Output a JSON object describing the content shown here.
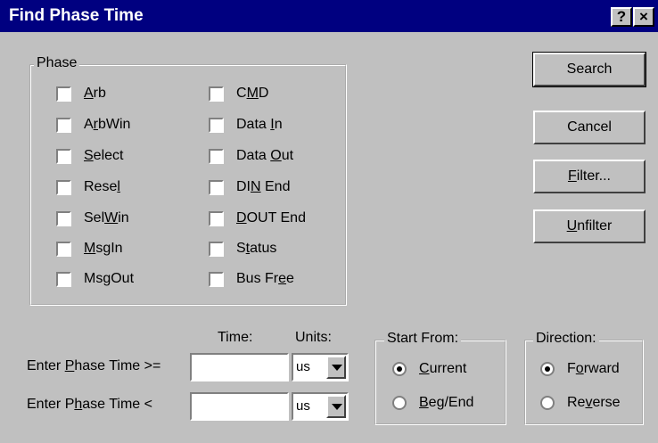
{
  "window": {
    "title": "Find Phase Time",
    "help_label": "?",
    "close_label": "×"
  },
  "phase": {
    "group_label": "Phase",
    "left": [
      {
        "pre": "",
        "u": "A",
        "post": "rb",
        "checked": false
      },
      {
        "pre": "A",
        "u": "r",
        "post": "bWin",
        "checked": false
      },
      {
        "pre": "",
        "u": "S",
        "post": "elect",
        "checked": false
      },
      {
        "pre": "Rese",
        "u": "l",
        "post": "",
        "checked": false
      },
      {
        "pre": "Sel",
        "u": "W",
        "post": "in",
        "checked": false
      },
      {
        "pre": "",
        "u": "M",
        "post": "sgIn",
        "checked": false
      },
      {
        "pre": "Ms",
        "u": "g",
        "post": "Out",
        "checked": false
      }
    ],
    "right": [
      {
        "pre": "C",
        "u": "M",
        "post": "D",
        "checked": false
      },
      {
        "pre": "Data ",
        "u": "I",
        "post": "n",
        "checked": false
      },
      {
        "pre": "Data ",
        "u": "O",
        "post": "ut",
        "checked": false
      },
      {
        "pre": "DI",
        "u": "N",
        "post": " End",
        "checked": false
      },
      {
        "pre": "",
        "u": "D",
        "post": "OUT End",
        "checked": false
      },
      {
        "pre": "S",
        "u": "t",
        "post": "atus",
        "checked": false
      },
      {
        "pre": "Bus Fr",
        "u": "e",
        "post": "e",
        "checked": false
      }
    ]
  },
  "buttons": {
    "search": "Search",
    "cancel": "Cancel",
    "filter": {
      "pre": "",
      "u": "F",
      "post": "ilter..."
    },
    "unfilter": {
      "pre": "",
      "u": "U",
      "post": "nfilter"
    }
  },
  "time": {
    "time_header": "Time:",
    "units_header": "Units:",
    "row1_label": {
      "pre": "Enter ",
      "u": "P",
      "post": "hase Time >="
    },
    "row2_label": {
      "pre": "Enter P",
      "u": "h",
      "post": "ase Time <"
    },
    "row1_value": "",
    "row2_value": "",
    "row1_units": "us",
    "row2_units": "us"
  },
  "start_from": {
    "label": "Start From:",
    "options": [
      {
        "pre": "",
        "u": "C",
        "post": "urrent",
        "selected": true
      },
      {
        "pre": "",
        "u": "B",
        "post": "eg/End",
        "selected": false
      }
    ]
  },
  "direction": {
    "label": "Direction:",
    "options": [
      {
        "pre": "F",
        "u": "o",
        "post": "rward",
        "selected": true
      },
      {
        "pre": "Re",
        "u": "v",
        "post": "erse",
        "selected": false
      }
    ]
  }
}
